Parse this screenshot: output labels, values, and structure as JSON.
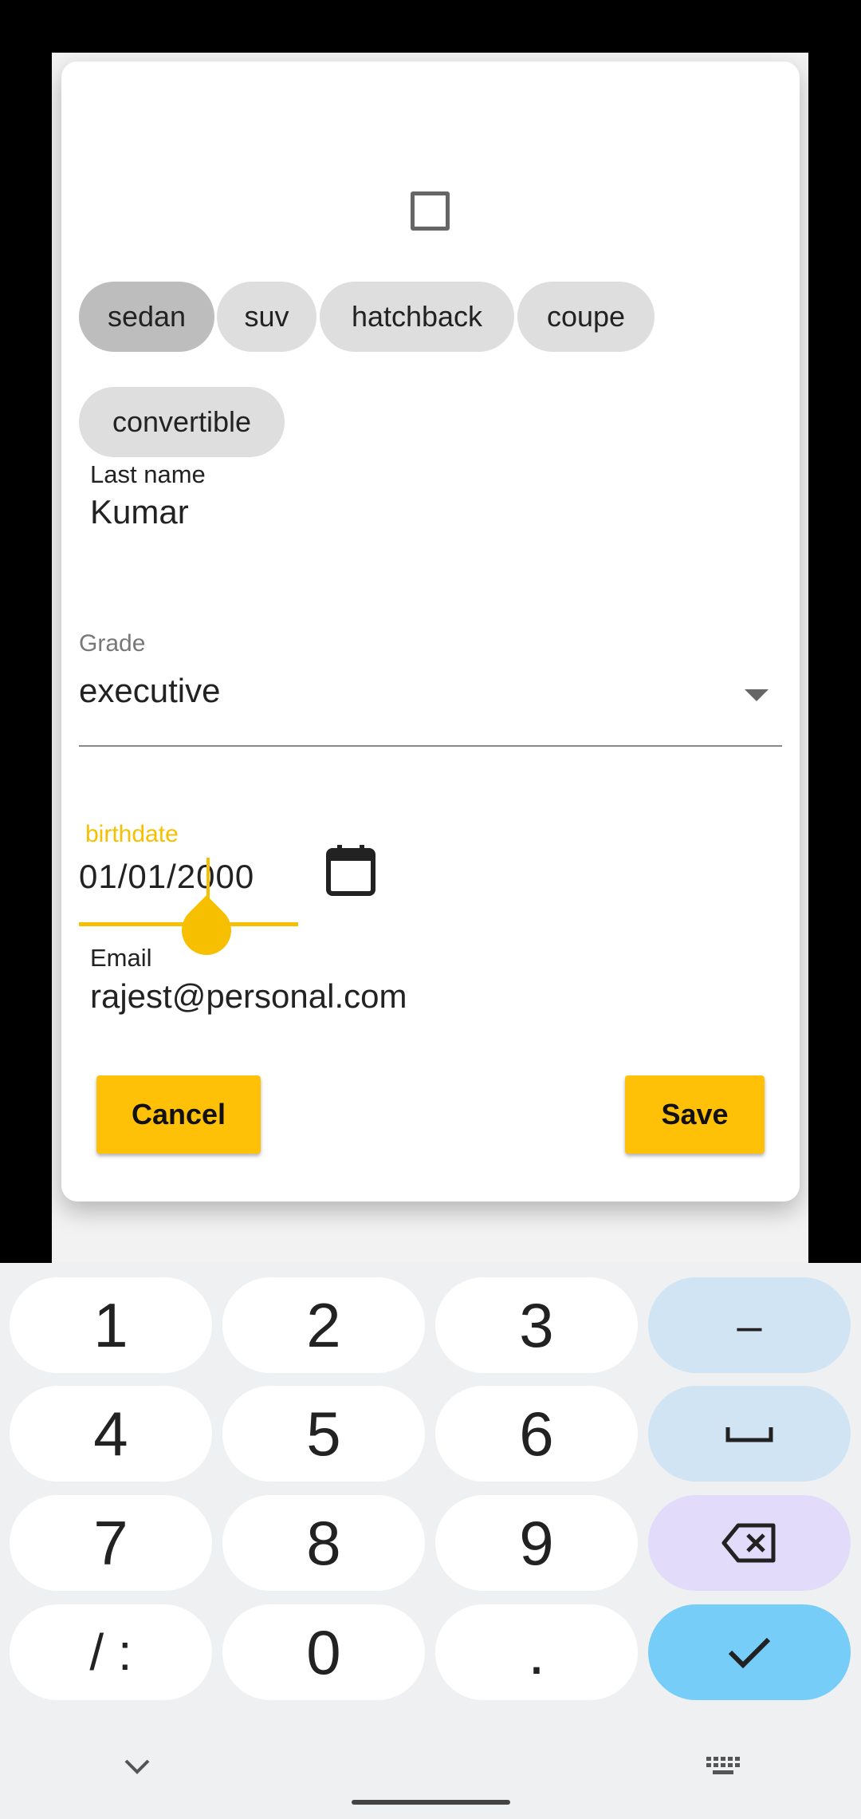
{
  "form": {
    "chips": [
      "sedan",
      "suv",
      "hatchback",
      "coupe",
      "convertible"
    ],
    "selected_chip": "sedan",
    "last_name": {
      "label": "Last name",
      "value": "Kumar"
    },
    "grade": {
      "label": "Grade",
      "value": "executive"
    },
    "birthdate": {
      "label": "birthdate",
      "value": "01/01/2000"
    },
    "email": {
      "label": "Email",
      "value": "rajest@personal.com"
    },
    "cancel_label": "Cancel",
    "save_label": "Save"
  },
  "keyboard": {
    "keys": [
      "1",
      "2",
      "3",
      "–",
      "4",
      "5",
      "6",
      "␣",
      "7",
      "8",
      "9",
      "⌫",
      "/ :",
      "0",
      ".",
      "✓"
    ]
  },
  "colors": {
    "accent": "#ffc107",
    "focus": "#f6c000",
    "chip": "#dedede",
    "chip_selected": "#bdbdbd",
    "key_fn": "#d1e4f4",
    "key_delete": "#e2dcfa",
    "key_done": "#75cdf8"
  }
}
